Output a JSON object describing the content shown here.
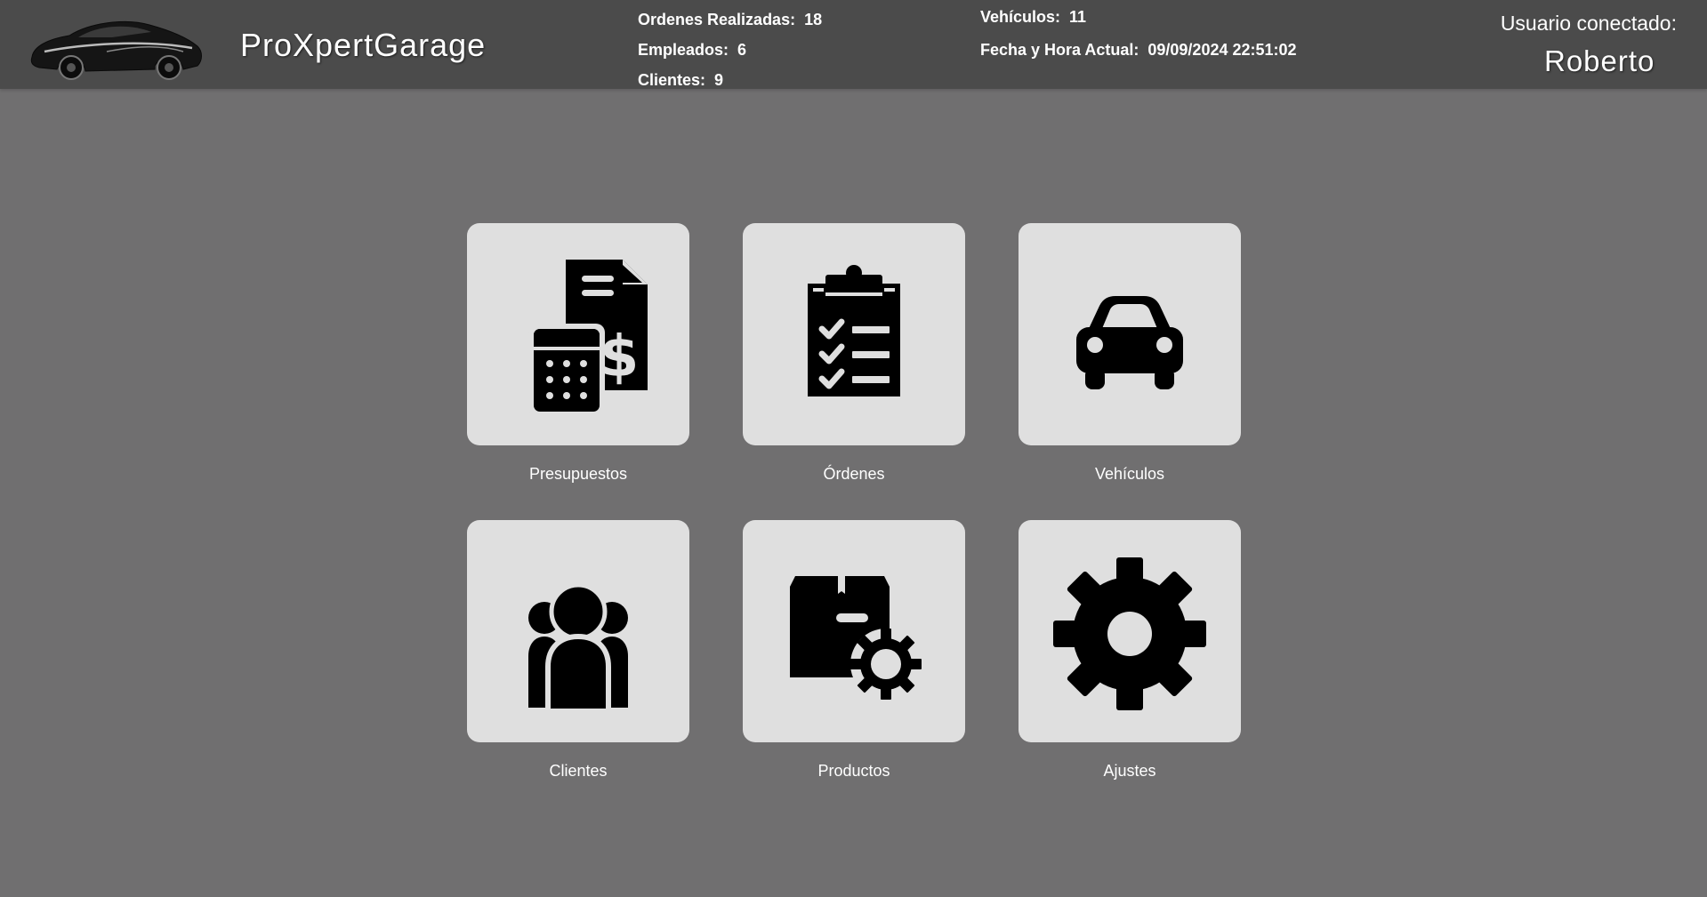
{
  "app": {
    "title": "ProXpertGarage"
  },
  "stats": {
    "ordenes": {
      "label": "Ordenes Realizadas:",
      "value": "18"
    },
    "empleados": {
      "label": "Empleados:",
      "value": "6"
    },
    "clientes": {
      "label": "Clientes:",
      "value": "9"
    },
    "vehiculos": {
      "label": "Vehículos:",
      "value": "11"
    },
    "fecha": {
      "label": "Fecha y Hora Actual:",
      "value": "09/09/2024 22:51:02"
    }
  },
  "user": {
    "label": "Usuario conectado:",
    "name": "Roberto"
  },
  "menu": [
    {
      "label": "Presupuestos",
      "icon": "budget-invoice-icon"
    },
    {
      "label": "Órdenes",
      "icon": "clipboard-checklist-icon"
    },
    {
      "label": "Vehículos",
      "icon": "car-icon"
    },
    {
      "label": "Clientes",
      "icon": "people-group-icon"
    },
    {
      "label": "Productos",
      "icon": "box-gear-icon"
    },
    {
      "label": "Ajustes",
      "icon": "gear-icon"
    }
  ],
  "colors": {
    "background": "#706f70",
    "header": "#4b4b4b",
    "tile": "#dfdfdf",
    "icon": "#000000",
    "text": "#ffffff"
  }
}
